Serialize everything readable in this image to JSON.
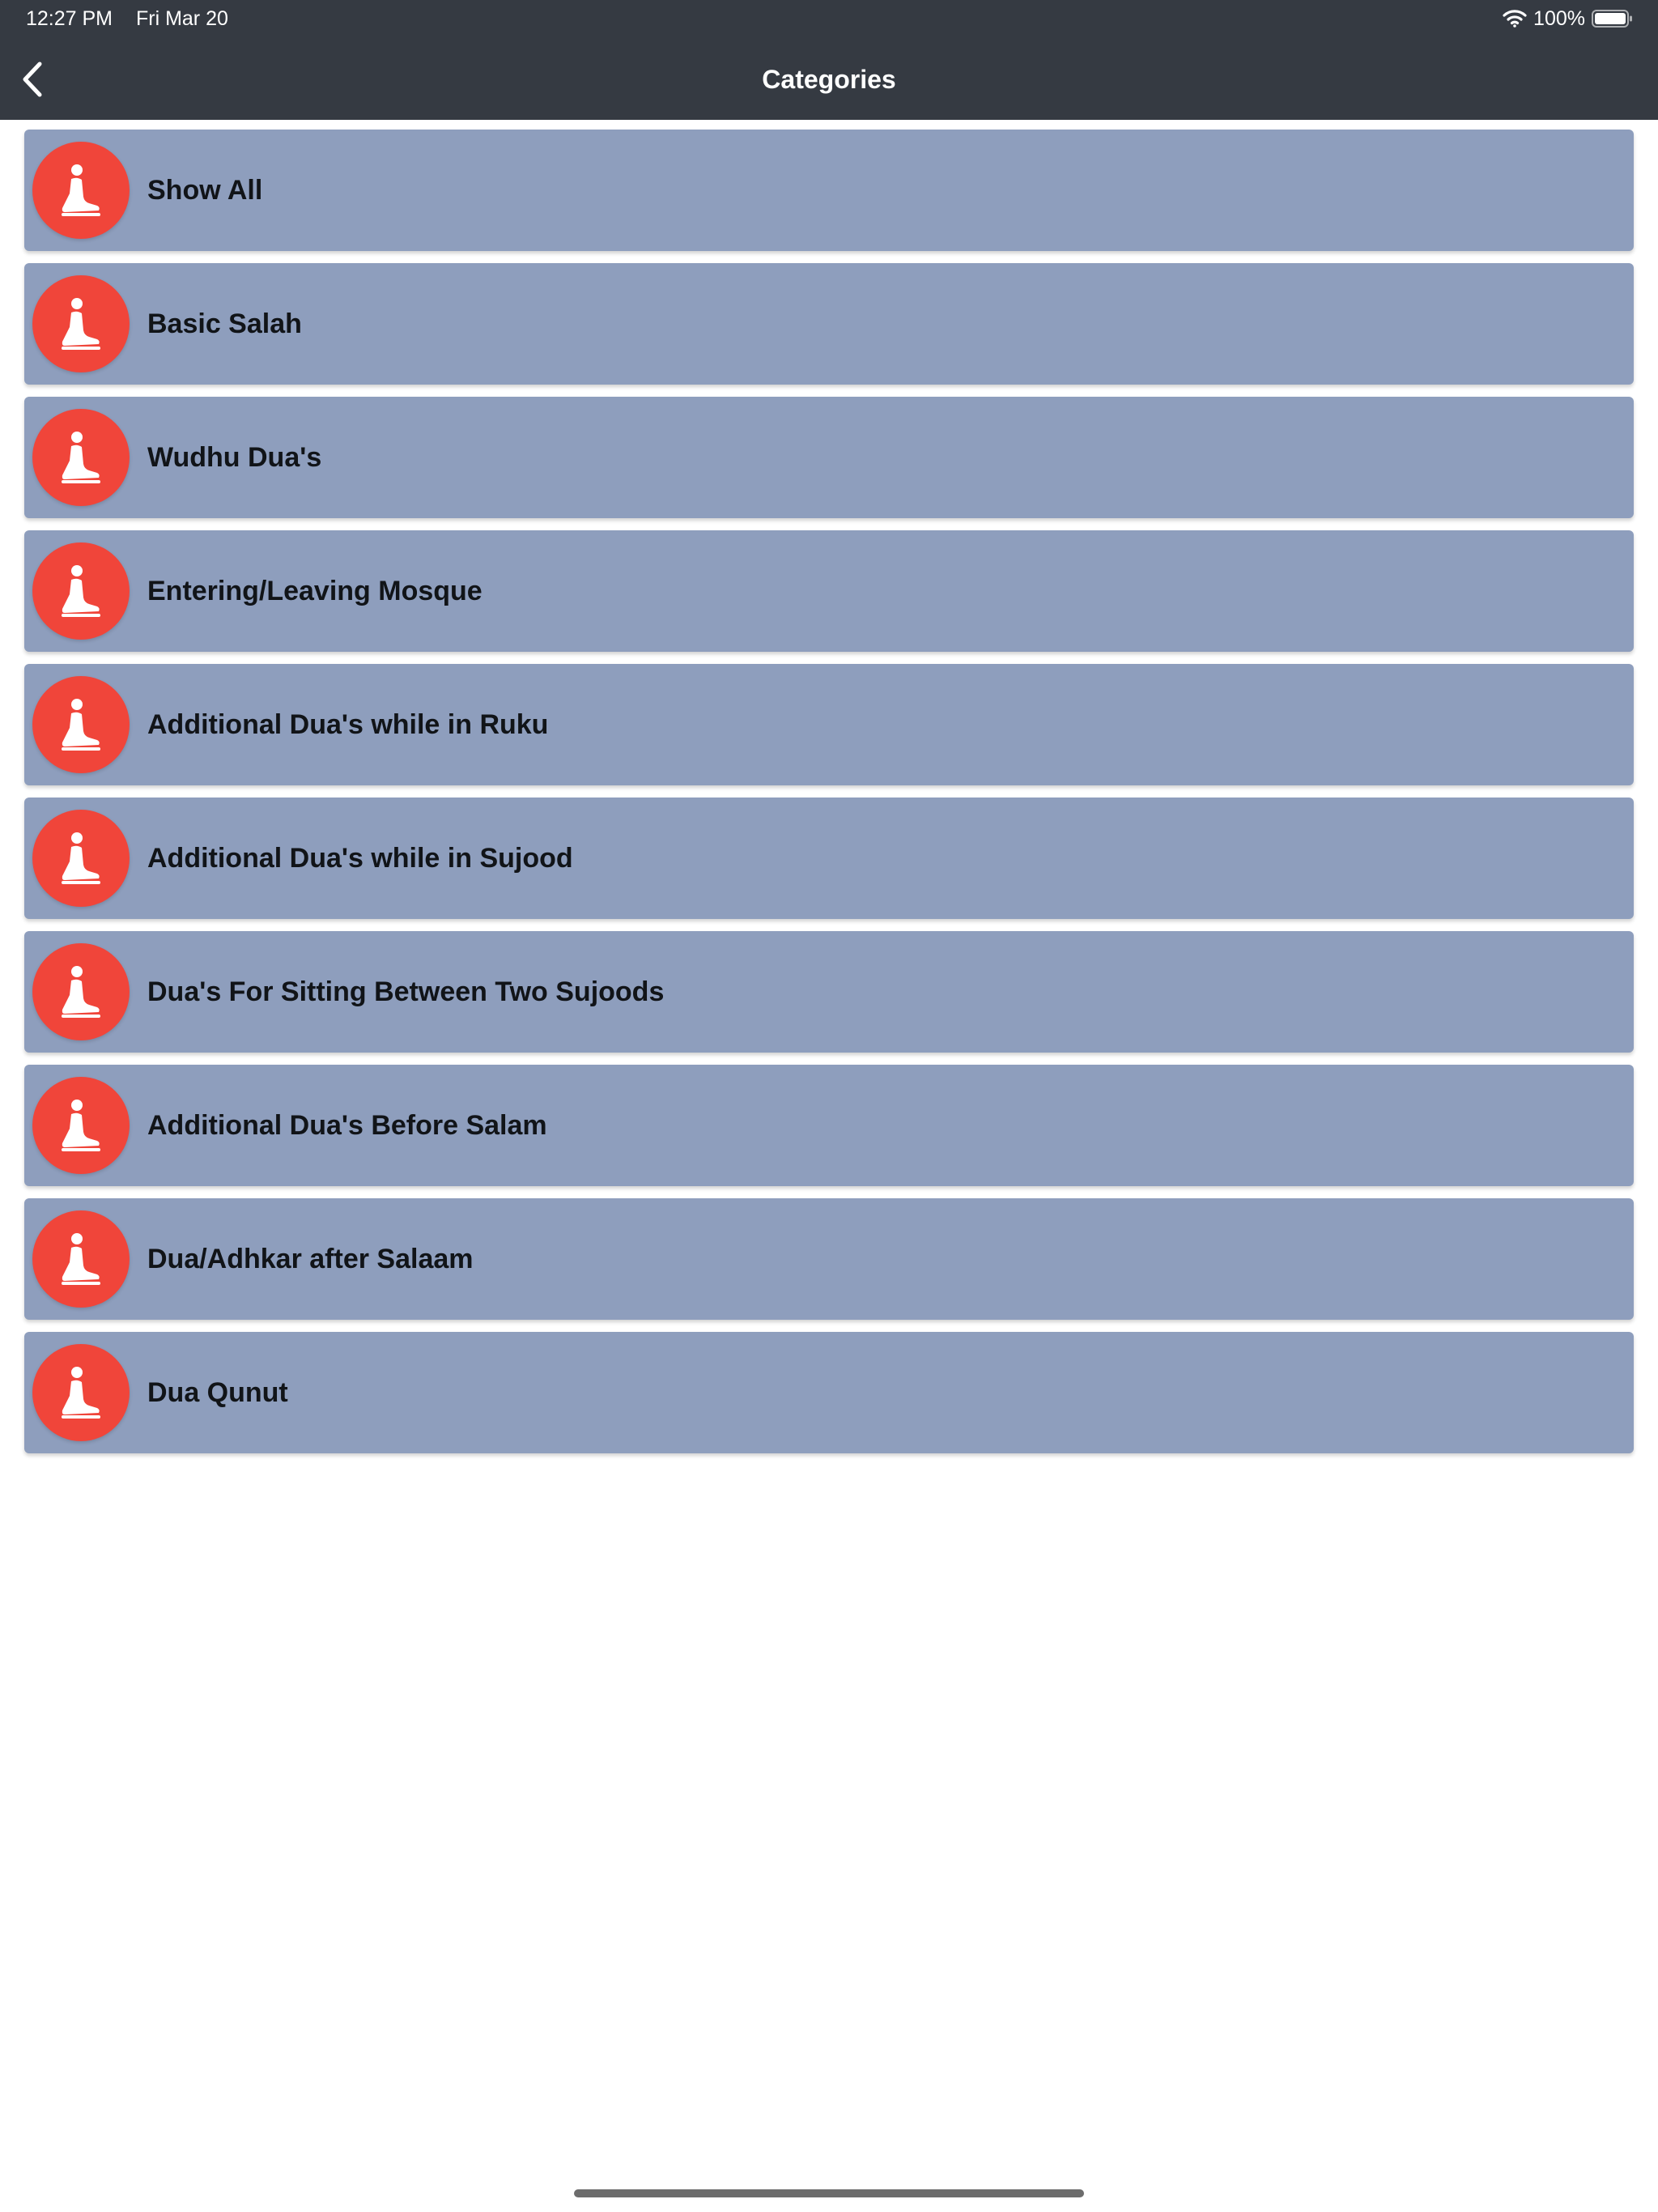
{
  "status_bar": {
    "time": "12:27 PM",
    "date": "Fri Mar 20",
    "battery": "100%"
  },
  "nav": {
    "back_icon": "chevron-left-icon",
    "title": "Categories"
  },
  "categories": [
    {
      "label": "Show All",
      "icon": "prayer-kneeling-icon"
    },
    {
      "label": "Basic Salah",
      "icon": "prayer-kneeling-icon"
    },
    {
      "label": "Wudhu Dua's",
      "icon": "prayer-kneeling-icon"
    },
    {
      "label": "Entering/Leaving Mosque",
      "icon": "prayer-kneeling-icon"
    },
    {
      "label": "Additional Dua's while in Ruku",
      "icon": "prayer-kneeling-icon"
    },
    {
      "label": "Additional Dua's while in Sujood",
      "icon": "prayer-kneeling-icon"
    },
    {
      "label": "Dua's For Sitting Between Two Sujoods",
      "icon": "prayer-kneeling-icon"
    },
    {
      "label": "Additional Dua's Before Salam",
      "icon": "prayer-kneeling-icon"
    },
    {
      "label": "Dua/Adhkar after Salaam",
      "icon": "prayer-kneeling-icon"
    },
    {
      "label": "Dua Qunut",
      "icon": "prayer-kneeling-icon"
    }
  ],
  "colors": {
    "header_bg": "#353a42",
    "row_bg": "#8e9ebd",
    "icon_bg": "#f0453a",
    "label_text": "#111418",
    "page_bg": "#ffffff"
  }
}
